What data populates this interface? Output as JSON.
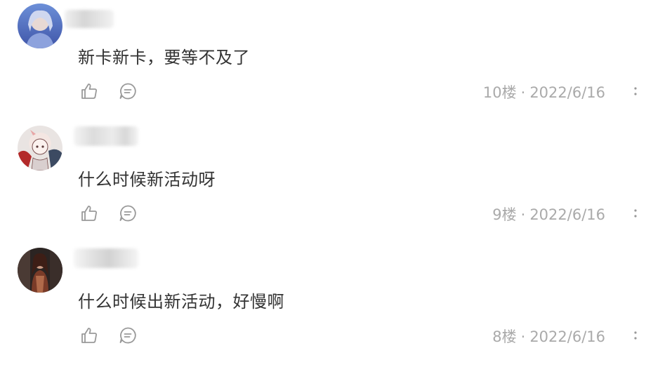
{
  "comments": [
    {
      "text": "新卡新卡，要等不及了",
      "floor": "10楼",
      "date": "2022/6/16",
      "separator": "·"
    },
    {
      "text": "什么时候新活动呀",
      "floor": "9楼",
      "date": "2022/6/16",
      "separator": "·"
    },
    {
      "text": "什么时候出新活动，好慢啊",
      "floor": "8楼",
      "date": "2022/6/16",
      "separator": "·"
    }
  ],
  "icons": {
    "like": "thumbs-up-icon",
    "reply": "comment-icon",
    "more": "more-vertical-icon"
  },
  "colors": {
    "text": "#333333",
    "meta": "#aaaaaa",
    "icon": "#999999"
  }
}
